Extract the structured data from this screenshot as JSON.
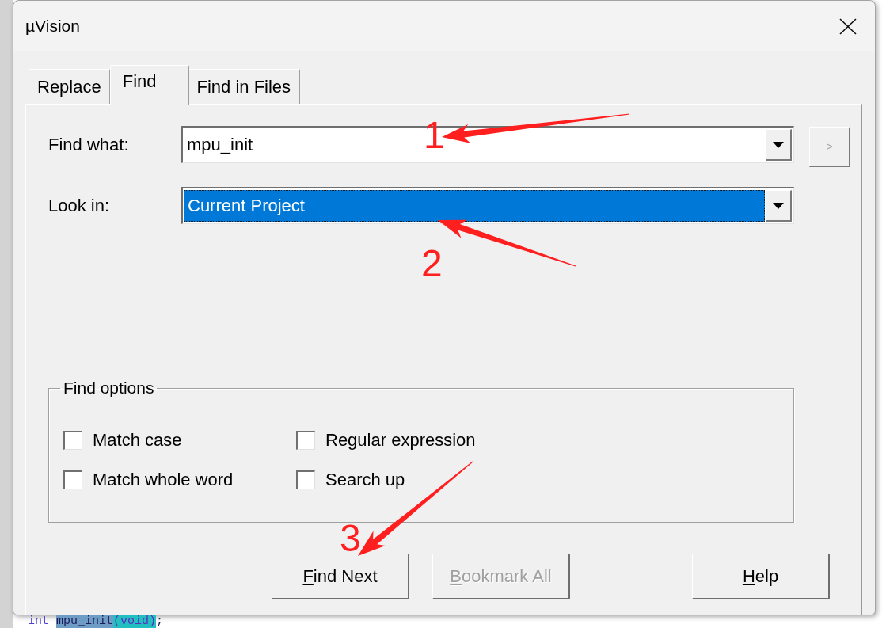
{
  "window": {
    "title": "µVision"
  },
  "tabs": [
    {
      "label": "Replace",
      "selected": false
    },
    {
      "label": "Find",
      "selected": true
    },
    {
      "label": "Find in Files",
      "selected": false
    }
  ],
  "find_what": {
    "label": "Find what:",
    "value": "mpu_init",
    "focused": false
  },
  "history_button": {
    "label": ">",
    "disabled": true
  },
  "look_in": {
    "label": "Look in:",
    "value": "Current Project",
    "focused": true
  },
  "find_options": {
    "title": "Find options",
    "options": [
      {
        "label": "Match case",
        "checked": false
      },
      {
        "label": "Regular expression",
        "checked": false
      },
      {
        "label": "Match whole word",
        "checked": false
      },
      {
        "label": "Search up",
        "checked": false
      }
    ]
  },
  "buttons": [
    {
      "label": "Find Next",
      "disabled": false,
      "mnemonic_underlined": true
    },
    {
      "label": "Bookmark All",
      "disabled": true,
      "mnemonic_underlined": true
    },
    {
      "label": "Help",
      "disabled": false,
      "mnemonic_underlined": true
    }
  ],
  "background_code": {
    "tokens": [
      {
        "text": "int",
        "kind": "keyword"
      },
      {
        "text": "mpu_init",
        "kind": "match"
      },
      {
        "text": "(void)",
        "kind": "paren"
      },
      {
        "text": ";",
        "kind": "plain"
      }
    ]
  },
  "annotations": [
    {
      "number": "1"
    },
    {
      "number": "2"
    },
    {
      "number": "3"
    }
  ]
}
